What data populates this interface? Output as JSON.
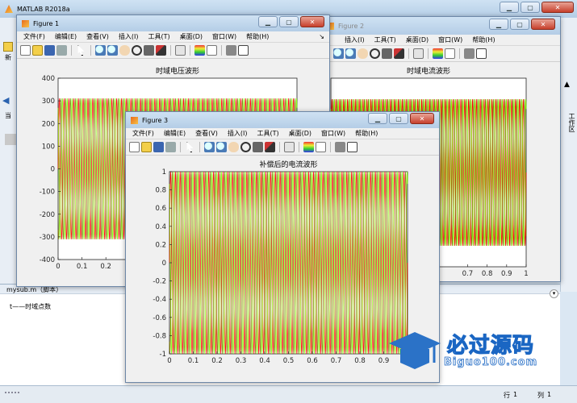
{
  "main_window": {
    "title": "MATLAB R2018a",
    "side_letters": [
      "新",
      "当"
    ],
    "workspace_label": "工作区",
    "script_name": "mysub.m（脚本）",
    "script_comment": "t——时域点数",
    "status_row_label": "行",
    "status_row_value": "1",
    "status_col_label": "列",
    "status_col_value": "1"
  },
  "figure_windows": [
    {
      "title": "Figure 1",
      "menu": [
        "文件(F)",
        "编辑(E)",
        "查看(V)",
        "插入(I)",
        "工具(T)",
        "桌面(D)",
        "窗口(W)",
        "帮助(H)"
      ]
    },
    {
      "title": "Figure 2",
      "menu": [
        "插入(I)",
        "工具(T)",
        "桌面(D)",
        "窗口(W)",
        "帮助(H)"
      ]
    },
    {
      "title": "Figure 3",
      "menu": [
        "文件(F)",
        "编辑(E)",
        "查看(V)",
        "插入(I)",
        "工具(T)",
        "桌面(D)",
        "窗口(W)",
        "帮助(H)"
      ]
    }
  ],
  "toolbar_icons": [
    "new-file-icon",
    "open-folder-icon",
    "save-icon",
    "print-icon",
    "pointer-icon",
    "zoom-in-icon",
    "zoom-out-icon",
    "pan-icon",
    "rotate-icon",
    "data-cursor-icon",
    "brush-icon",
    "link-icon",
    "colorbar-icon",
    "legend-icon",
    "hide-plot-tools-icon",
    "show-plot-tools-icon"
  ],
  "watermark": {
    "brand": "必过源码",
    "url": "Biguo100.com"
  },
  "colors": {
    "red": "#ff0000",
    "green": "#80ff00",
    "olive": "#808000"
  },
  "chart_data": [
    {
      "type": "line",
      "title": "时域电压波形",
      "x_ticks": [
        "0",
        "0.1",
        "0.2"
      ],
      "y_ticks": [
        "400",
        "300",
        "200",
        "100",
        "0",
        "-100",
        "-200",
        "-300",
        "-400"
      ],
      "xlim": [
        0,
        1
      ],
      "ylim": [
        -400,
        400
      ],
      "amplitude": 311,
      "cycles": 50,
      "series": [
        {
          "color": "#ff0000"
        },
        {
          "color": "#80ff00"
        },
        {
          "color": "#808000"
        }
      ]
    },
    {
      "type": "line",
      "title": "时域电流波形",
      "x_ticks": [
        "0.7",
        "0.8",
        "0.9",
        "1"
      ],
      "xlim": [
        0,
        1
      ],
      "ylim": [
        -400,
        400
      ],
      "amplitude": 311,
      "cycles": 50,
      "series": [
        {
          "color": "#ff0000"
        },
        {
          "color": "#80ff00"
        },
        {
          "color": "#808000"
        }
      ]
    },
    {
      "type": "line",
      "title": "补偿后的电流波形",
      "x_ticks": [
        "0",
        "0.1",
        "0.2",
        "0.3",
        "0.4",
        "0.5",
        "0.6",
        "0.7",
        "0.8",
        "0.9",
        "1"
      ],
      "y_ticks": [
        "1",
        "0.8",
        "0.6",
        "0.4",
        "0.2",
        "0",
        "-0.2",
        "-0.4",
        "-0.6",
        "-0.8",
        "-1"
      ],
      "xlim": [
        0,
        1
      ],
      "ylim": [
        -1,
        1
      ],
      "amplitude": 1,
      "cycles": 50,
      "series": [
        {
          "color": "#ff0000"
        },
        {
          "color": "#80ff00"
        },
        {
          "color": "#808000"
        }
      ]
    }
  ]
}
